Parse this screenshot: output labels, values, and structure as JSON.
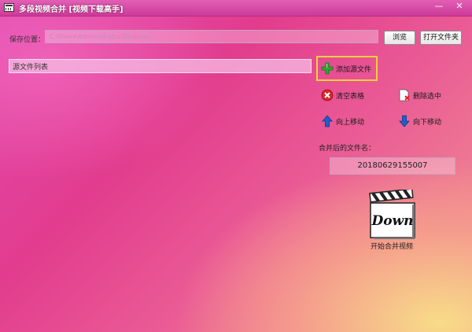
{
  "window": {
    "title": "多段视频合并 [视频下载高手]",
    "minimize_glyph": "—",
    "close_glyph": "✕"
  },
  "save": {
    "label": "保存位置：",
    "path_value": "C:\\Users\\Administrator\\Desktop\\",
    "browse_label": "浏览",
    "open_folder_label": "打开文件夹"
  },
  "file_list": {
    "header": "源文件列表"
  },
  "actions": {
    "add_source": "添加源文件",
    "clear_table": "清空表格",
    "delete_selected": "删除选中",
    "move_up": "向上移动",
    "move_down": "向下移动"
  },
  "merged": {
    "label": "合并后的文件名：",
    "filename": "20180629155007"
  },
  "start": {
    "icon_text": "Down",
    "label": "开始合并视频"
  },
  "colors": {
    "highlight_border": "#f3d13a",
    "plus_green": "#2ea82e",
    "delete_red": "#d9262c",
    "arrow_blue": "#1f5fc9"
  }
}
